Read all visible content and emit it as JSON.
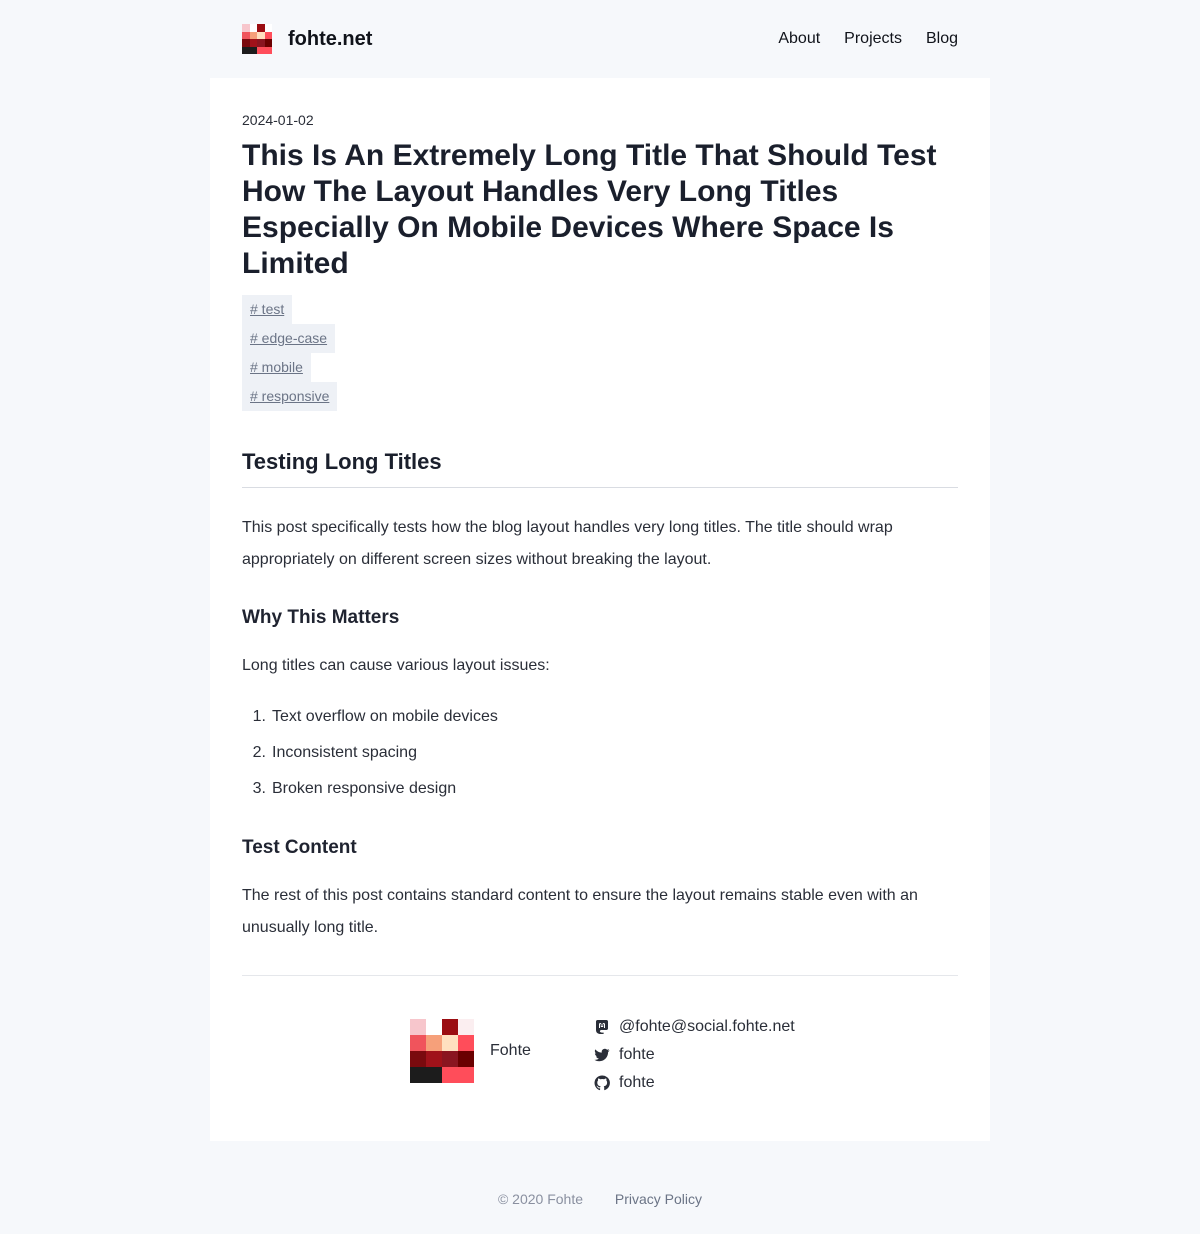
{
  "site": {
    "name": "fohte.net",
    "nav": [
      "About",
      "Projects",
      "Blog"
    ]
  },
  "post": {
    "date": "2024-01-02",
    "title": "This Is An Extremely Long Title That Should Test How The Layout Handles Very Long Titles Especially On Mobile Devices Where Space Is Limited",
    "tags": [
      "# test",
      "# edge-case",
      "# mobile",
      "# responsive"
    ],
    "h2": "Testing Long Titles",
    "intro": "This post specifically tests how the blog layout handles very long titles. The title should wrap appropriately on different screen sizes without breaking the layout.",
    "section1_title": "Why This Matters",
    "section1_text": "Long titles can cause various layout issues:",
    "list": [
      "Text overflow on mobile devices",
      "Inconsistent spacing",
      "Broken responsive design"
    ],
    "list_numbers": [
      "1.",
      "2.",
      "3."
    ],
    "section2_title": "Test Content",
    "section2_text": "The rest of this post contains standard content to ensure the layout remains stable even with an unusually long title."
  },
  "author": {
    "name": "Fohte",
    "mastodon": "@fohte@social.fohte.net",
    "twitter": "fohte",
    "github": "fohte"
  },
  "footer": {
    "copyright": "© 2020 Fohte",
    "privacy": "Privacy Policy"
  },
  "colors": {
    "background": "#f6f8fb",
    "card": "#ffffff",
    "tag_bg": "#eef1f6",
    "tag_text": "#6b7486"
  }
}
